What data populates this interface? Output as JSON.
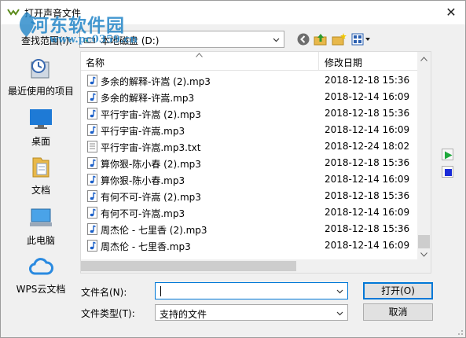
{
  "window": {
    "title": "打开声音文件",
    "close_glyph": "✕"
  },
  "watermark": {
    "main": "河东软件园",
    "sub": "www.pc0359.cn"
  },
  "lookin": {
    "label": "查找范围(I):",
    "value": "本地磁盘 (D:)"
  },
  "toolbar": {
    "icons": [
      "back-icon",
      "up-folder-icon",
      "new-folder-icon",
      "view-menu-icon"
    ]
  },
  "places": [
    {
      "label": "最近使用的项目",
      "icon": "recent-items-icon"
    },
    {
      "label": "桌面",
      "icon": "desktop-icon"
    },
    {
      "label": "文档",
      "icon": "documents-icon"
    },
    {
      "label": "此电脑",
      "icon": "computer-icon"
    },
    {
      "label": "WPS云文档",
      "icon": "cloud-icon"
    }
  ],
  "list": {
    "columns": {
      "name": "名称",
      "modified": "修改日期"
    },
    "rows": [
      {
        "name": "多余的解释-许嵩 (2).mp3",
        "date": "2018-12-18 15:36",
        "type": "audio"
      },
      {
        "name": "多余的解释-许嵩.mp3",
        "date": "2018-12-14 16:09",
        "type": "audio"
      },
      {
        "name": "平行宇宙-许嵩 (2).mp3",
        "date": "2018-12-18 15:36",
        "type": "audio"
      },
      {
        "name": "平行宇宙-许嵩.mp3",
        "date": "2018-12-14 16:09",
        "type": "audio"
      },
      {
        "name": "平行宇宙-许嵩.mp3.txt",
        "date": "2018-12-24 18:02",
        "type": "text"
      },
      {
        "name": "算你狠-陈小春 (2).mp3",
        "date": "2018-12-18 15:36",
        "type": "audio"
      },
      {
        "name": "算你狠-陈小春.mp3",
        "date": "2018-12-14 16:09",
        "type": "audio"
      },
      {
        "name": "有何不可-许嵩 (2).mp3",
        "date": "2018-12-18 15:36",
        "type": "audio"
      },
      {
        "name": "有何不可-许嵩.mp3",
        "date": "2018-12-14 16:09",
        "type": "audio"
      },
      {
        "name": "周杰伦 - 七里香 (2).mp3",
        "date": "2018-12-18 15:36",
        "type": "audio"
      },
      {
        "name": "周杰伦 - 七里香.mp3",
        "date": "2018-12-14 16:09",
        "type": "audio"
      }
    ]
  },
  "filename": {
    "label": "文件名(N):",
    "value": ""
  },
  "filetype": {
    "label": "文件类型(T):",
    "value": "支持的文件"
  },
  "buttons": {
    "open": "打开(O)",
    "cancel": "取消"
  },
  "colors": {
    "accent": "#0078d7",
    "watermark": "#2386c8",
    "play": "#1ea83c",
    "stop": "#1a2bd8"
  }
}
